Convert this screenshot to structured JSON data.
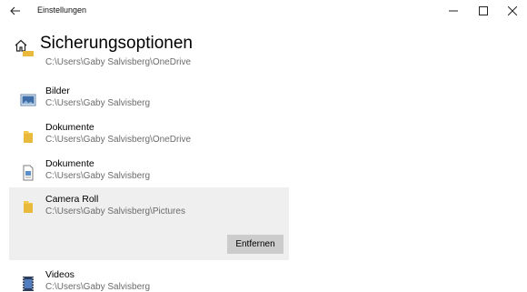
{
  "window": {
    "title": "Einstellungen",
    "back_icon": "arrow-left-icon",
    "controls": [
      "minimize-icon",
      "maximize-icon",
      "close-icon"
    ]
  },
  "header": {
    "home_icon": "home-icon",
    "title": "Sicherungsoptionen"
  },
  "folders": [
    {
      "name": "",
      "path": "C:\\Users\\Gaby Salvisberg\\OneDrive",
      "icon": "folder-icon"
    },
    {
      "name": "Bilder",
      "path": "C:\\Users\\Gaby Salvisberg",
      "icon": "pictures-folder-icon"
    },
    {
      "name": "Dokumente",
      "path": "C:\\Users\\Gaby Salvisberg\\OneDrive",
      "icon": "folder-icon"
    },
    {
      "name": "Dokumente",
      "path": "C:\\Users\\Gaby Salvisberg",
      "icon": "documents-folder-icon"
    },
    {
      "name": "Camera Roll",
      "path": "C:\\Users\\Gaby Salvisberg\\Pictures",
      "icon": "folder-icon",
      "selected": true
    },
    {
      "name": "Videos",
      "path": "C:\\Users\\Gaby Salvisberg",
      "icon": "videos-folder-icon"
    }
  ],
  "actions": {
    "remove_label": "Entfernen"
  }
}
